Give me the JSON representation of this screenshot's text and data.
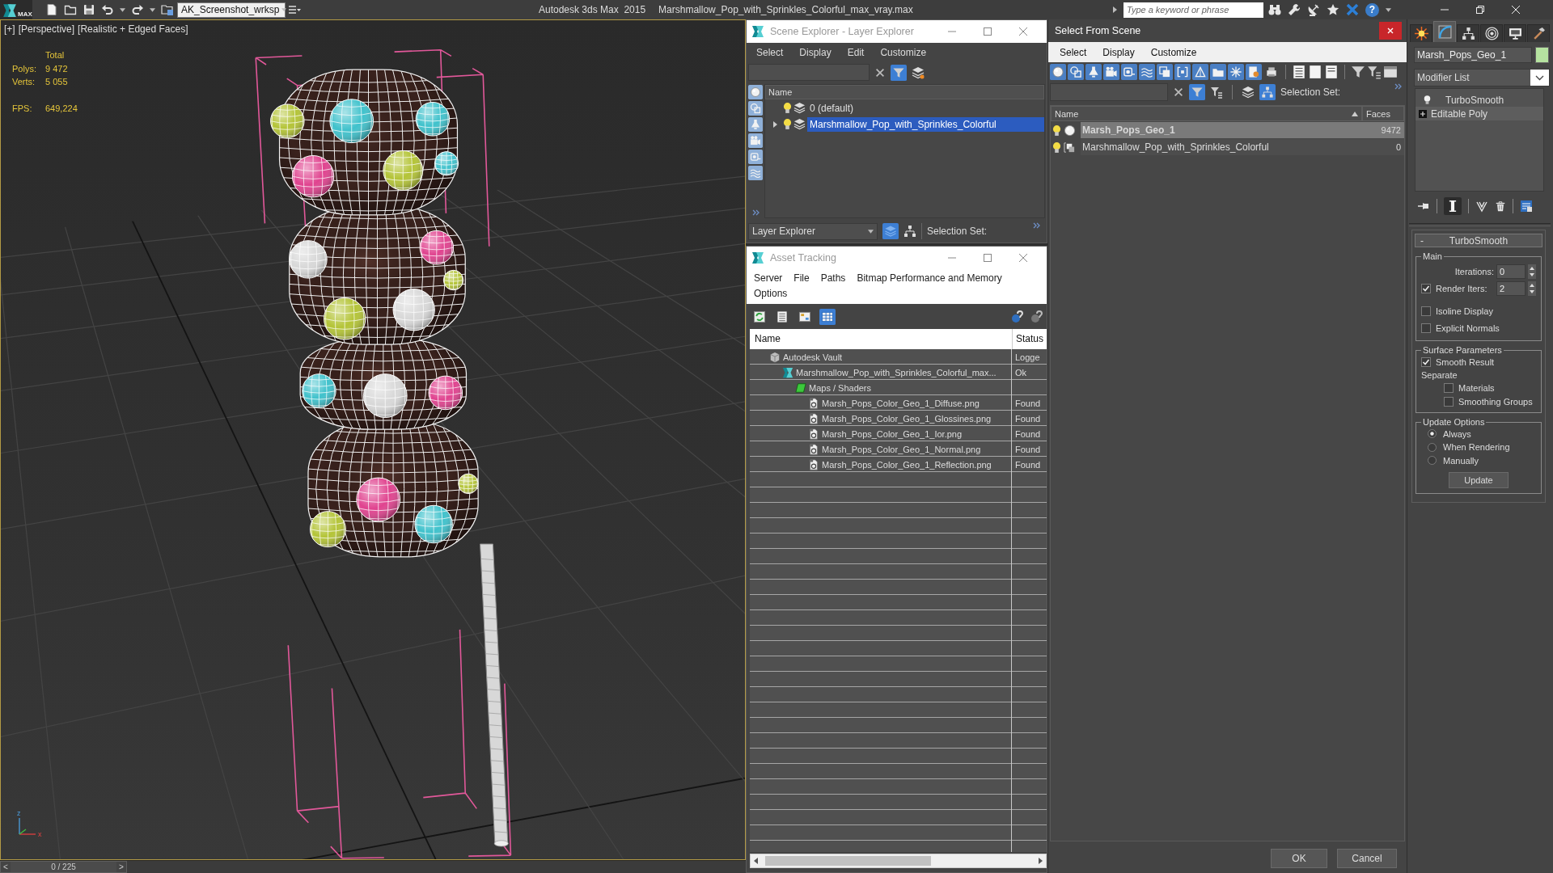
{
  "app_bar": {
    "logo": "MAX",
    "workspace": "AK_Screenshot_wrksp",
    "title": "Autodesk 3ds Max  2015",
    "file_name": "Marshmallow_Pop_with_Sprinkles_Colorful_max_vray.max",
    "search": {
      "placeholder": "Type a keyword or phrase"
    },
    "help": "?"
  },
  "viewport": {
    "labels": [
      "[+]",
      "[Perspective]",
      "[Realistic + Edged Faces]"
    ],
    "stats": {
      "heading": "Total",
      "rows": [
        {
          "label": "Polys:",
          "value": "9 472"
        },
        {
          "label": "Verts:",
          "value": "5 055"
        }
      ]
    },
    "fps": {
      "label": "FPS:",
      "value": "649,224"
    },
    "axis_labels": [
      "z",
      "x"
    ]
  },
  "timeline": {
    "prev": "<",
    "frame": "0 / 225",
    "next": ">",
    "level": 0
  },
  "scene_explorer": {
    "title": "Scene Explorer - Layer Explorer",
    "menu": [
      "Select",
      "Display",
      "Edit",
      "Customize"
    ],
    "filter_active": true,
    "column": "Name",
    "layers": [
      {
        "name": "0 (default)",
        "collapsed": false,
        "selected": false
      },
      {
        "name": "Marshmallow_Pop_with_Sprinkles_Colorful",
        "collapsed": true,
        "selected": true
      }
    ],
    "footer": {
      "mode": "Layer Explorer",
      "layers_active": true,
      "selection_set": "Selection Set:"
    }
  },
  "asset_tracking": {
    "title": "Asset Tracking",
    "menu": [
      "Server",
      "File",
      "Paths",
      "Bitmap Performance and Memory",
      "Options"
    ],
    "toolbar": [
      {
        "active": false
      },
      {
        "active": false
      },
      {
        "active": false
      },
      {
        "active": true
      }
    ],
    "columns": [
      "Name",
      "Status"
    ],
    "tree": [
      {
        "name": "Autodesk Vault",
        "status": "Logge",
        "kind": "vault",
        "children": [
          {
            "name": "Marshmallow_Pop_with_Sprinkles_Colorful_max...",
            "status": "Ok",
            "kind": "scene",
            "children": [
              {
                "name": "Maps / Shaders",
                "kind": "folder",
                "children": [
                  {
                    "name": "Marsh_Pops_Color_Geo_1_Diffuse.png",
                    "status": "Found",
                    "kind": "bitmap"
                  },
                  {
                    "name": "Marsh_Pops_Color_Geo_1_Glossines.png",
                    "status": "Found",
                    "kind": "bitmap"
                  },
                  {
                    "name": "Marsh_Pops_Color_Geo_1_Ior.png",
                    "status": "Found",
                    "kind": "bitmap"
                  },
                  {
                    "name": "Marsh_Pops_Color_Geo_1_Normal.png",
                    "status": "Found",
                    "kind": "bitmap"
                  },
                  {
                    "name": "Marsh_Pops_Color_Geo_1_Reflection.png",
                    "status": "Found",
                    "kind": "bitmap"
                  }
                ]
              }
            ]
          }
        ]
      }
    ]
  },
  "select_from_scene": {
    "title": "Select From Scene",
    "menu": [
      "Select",
      "Display",
      "Customize"
    ],
    "type_filters": [
      {
        "active": true
      },
      {
        "active": true
      },
      {
        "active": true
      },
      {
        "active": true
      },
      {
        "active": true
      },
      {
        "active": true
      },
      {
        "active": true
      },
      {
        "active": true
      },
      {
        "active": true
      },
      {
        "active": true
      },
      {
        "active": true
      },
      {
        "active": true
      },
      {
        "active": false
      }
    ],
    "filter_active": true,
    "hierarchy_active": true,
    "selection_set": "Selection Set:",
    "columns": [
      "Name",
      "Faces"
    ],
    "rows": [
      {
        "name": "Marsh_Pops_Geo_1",
        "faces": "9472",
        "kind": "geometry",
        "selected": true
      },
      {
        "name": "Marshmallow_Pop_with_Sprinkles_Colorful",
        "faces": "0",
        "kind": "group",
        "selected": false
      }
    ],
    "buttons": [
      "OK",
      "Cancel"
    ]
  },
  "command_panel": {
    "tabs": [
      {
        "selected": false
      },
      {
        "selected": true
      },
      {
        "selected": false
      },
      {
        "selected": false
      },
      {
        "selected": false
      },
      {
        "selected": false
      }
    ],
    "object": {
      "name": "Marsh_Pops_Geo_1",
      "color": "#b6e3a0"
    },
    "modifier_list": "Modifier List",
    "stack": [
      {
        "name": "TurboSmooth",
        "kind": "modifier"
      },
      {
        "name": "Editable Poly",
        "kind": "base"
      }
    ],
    "show_end_result": true,
    "rollout": {
      "toggle": "-",
      "title": "TurboSmooth",
      "groups": [
        {
          "title": "Main",
          "controls": [
            {
              "kind": "spinner",
              "label": "Iterations:",
              "value": "0"
            },
            {
              "kind": "check_spinner",
              "label": "Render Iters:",
              "checked": true,
              "value": "2"
            },
            {
              "kind": "checkbox",
              "label": "Isoline Display",
              "checked": false
            },
            {
              "kind": "checkbox",
              "label": "Explicit Normals",
              "checked": false
            }
          ]
        },
        {
          "title": "Surface Parameters",
          "controls": [
            {
              "kind": "checkbox",
              "label": "Smooth Result",
              "checked": true
            },
            {
              "kind": "label",
              "label": "Separate",
              "children": [
                {
                  "kind": "checkbox",
                  "label": "Materials",
                  "checked": false
                },
                {
                  "kind": "checkbox",
                  "label": "Smoothing Groups",
                  "checked": false
                }
              ]
            }
          ]
        },
        {
          "title": "Update Options",
          "controls": [
            {
              "kind": "radio",
              "label": "Always",
              "selected": true
            },
            {
              "kind": "radio",
              "label": "When Rendering",
              "selected": false
            },
            {
              "kind": "radio",
              "label": "Manually",
              "selected": false
            },
            {
              "kind": "button",
              "label": "Update"
            }
          ]
        }
      ]
    }
  }
}
